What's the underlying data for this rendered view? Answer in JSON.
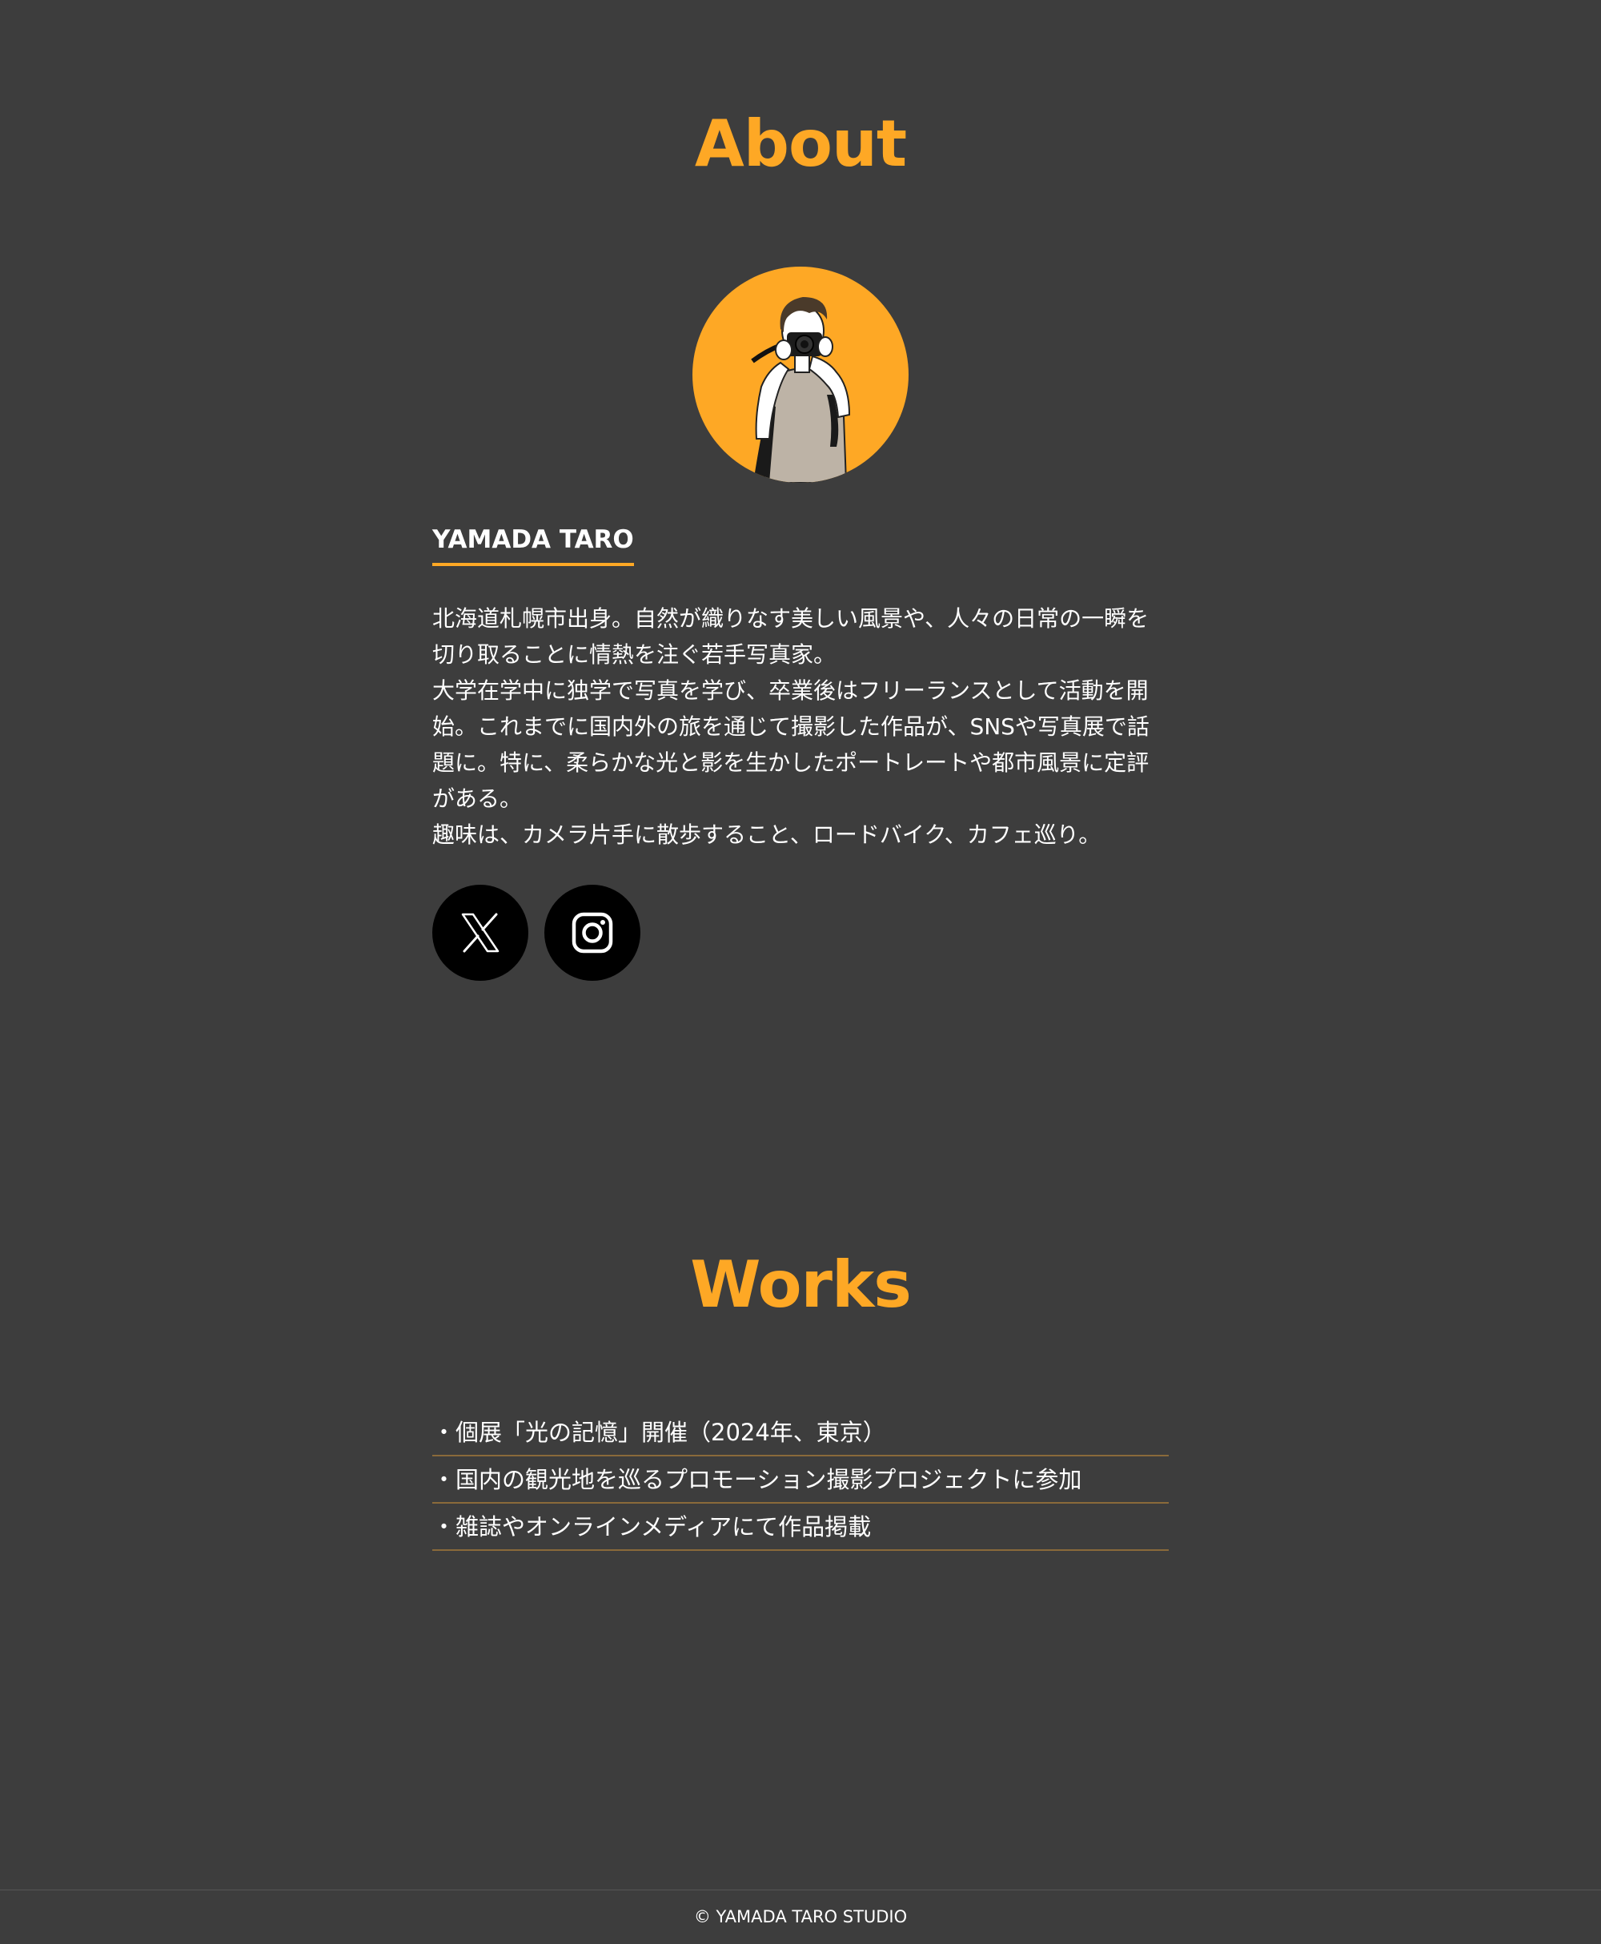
{
  "about": {
    "title": "About",
    "name": "YAMADA TARO",
    "bio": [
      "北海道札幌市出身。自然が織りなす美しい風景や、人々の日常の一瞬を切り取ることに情熱を注ぐ若手写真家。",
      "大学在学中に独学で写真を学び、卒業後はフリーランスとして活動を開始。これまでに国内外の旅を通じて撮影した作品が、SNSや写真展で話題に。特に、柔らかな光と影を生かしたポートレートや都市風景に定評がある。",
      "趣味は、カメラ片手に散歩すること、ロードバイク、カフェ巡り。"
    ],
    "avatar_icon": "photographer-illustration",
    "social": [
      {
        "icon": "x-icon"
      },
      {
        "icon": "instagram-icon"
      }
    ]
  },
  "works": {
    "title": "Works",
    "items": [
      "・個展「光の記憶」開催（2024年、東京）",
      "・国内の観光地を巡るプロモーション撮影プロジェクトに参加",
      "・雑誌やオンラインメディアにて作品掲載"
    ]
  },
  "footer": {
    "copyright": "© YAMADA TARO STUDIO"
  },
  "colors": {
    "background": "#3d3d3d",
    "accent": "#fea825",
    "text": "#ffffff",
    "divider": "#8a6a3a"
  }
}
